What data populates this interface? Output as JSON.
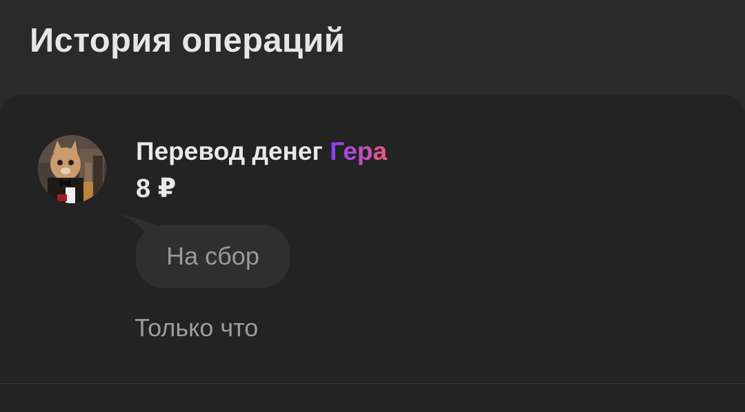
{
  "header": {
    "title": "История операций"
  },
  "operation": {
    "avatar_icon": "user-avatar",
    "title_prefix": "Перевод денег",
    "recipient": "Гера",
    "amount": "8 ₽",
    "comment": "На сбор",
    "timestamp": "Только что",
    "colors": {
      "recipient_gradient_start": "#8a3cf2",
      "recipient_gradient_end": "#ee5a7a",
      "background": "#2a2a2b",
      "card_background": "#232324",
      "bubble_background": "#2f2f30"
    }
  }
}
